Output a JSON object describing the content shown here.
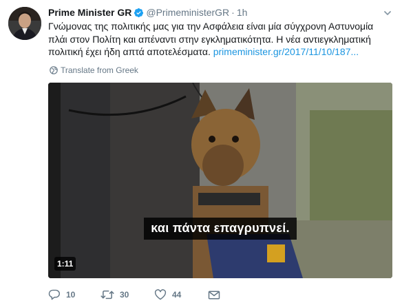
{
  "author": {
    "display_name": "Prime Minister GR",
    "handle": "@PrimeministerGR",
    "separator": "·",
    "time": "1h",
    "verified": true
  },
  "tweet": {
    "text": "Γνώμονας της πολιτικής μας για την Ασφάλεια είναι μία σύγχρονη Αστυνομία πλάι στον Πολίτη και απέναντι στην εγκληματικότητα. Η νέα αντιεγκληματική πολιτική έχει ήδη απτά αποτελέσματα.",
    "link": "primeminister.gr/2017/11/10/187...",
    "translate_label": "Translate from Greek"
  },
  "video": {
    "subtitle": "και πάντα επαγρυπνεί.",
    "duration": "1:11"
  },
  "actions": {
    "replies": "10",
    "retweets": "30",
    "likes": "44"
  },
  "icons": {
    "verified": "verified-badge-icon",
    "caret": "chevron-down-icon",
    "translate": "globe-icon",
    "reply": "reply-icon",
    "retweet": "retweet-icon",
    "like": "heart-icon",
    "dm": "envelope-icon"
  },
  "colors": {
    "link": "#1b95e0",
    "secondary_text": "#657786",
    "verified": "#1da1f2"
  }
}
